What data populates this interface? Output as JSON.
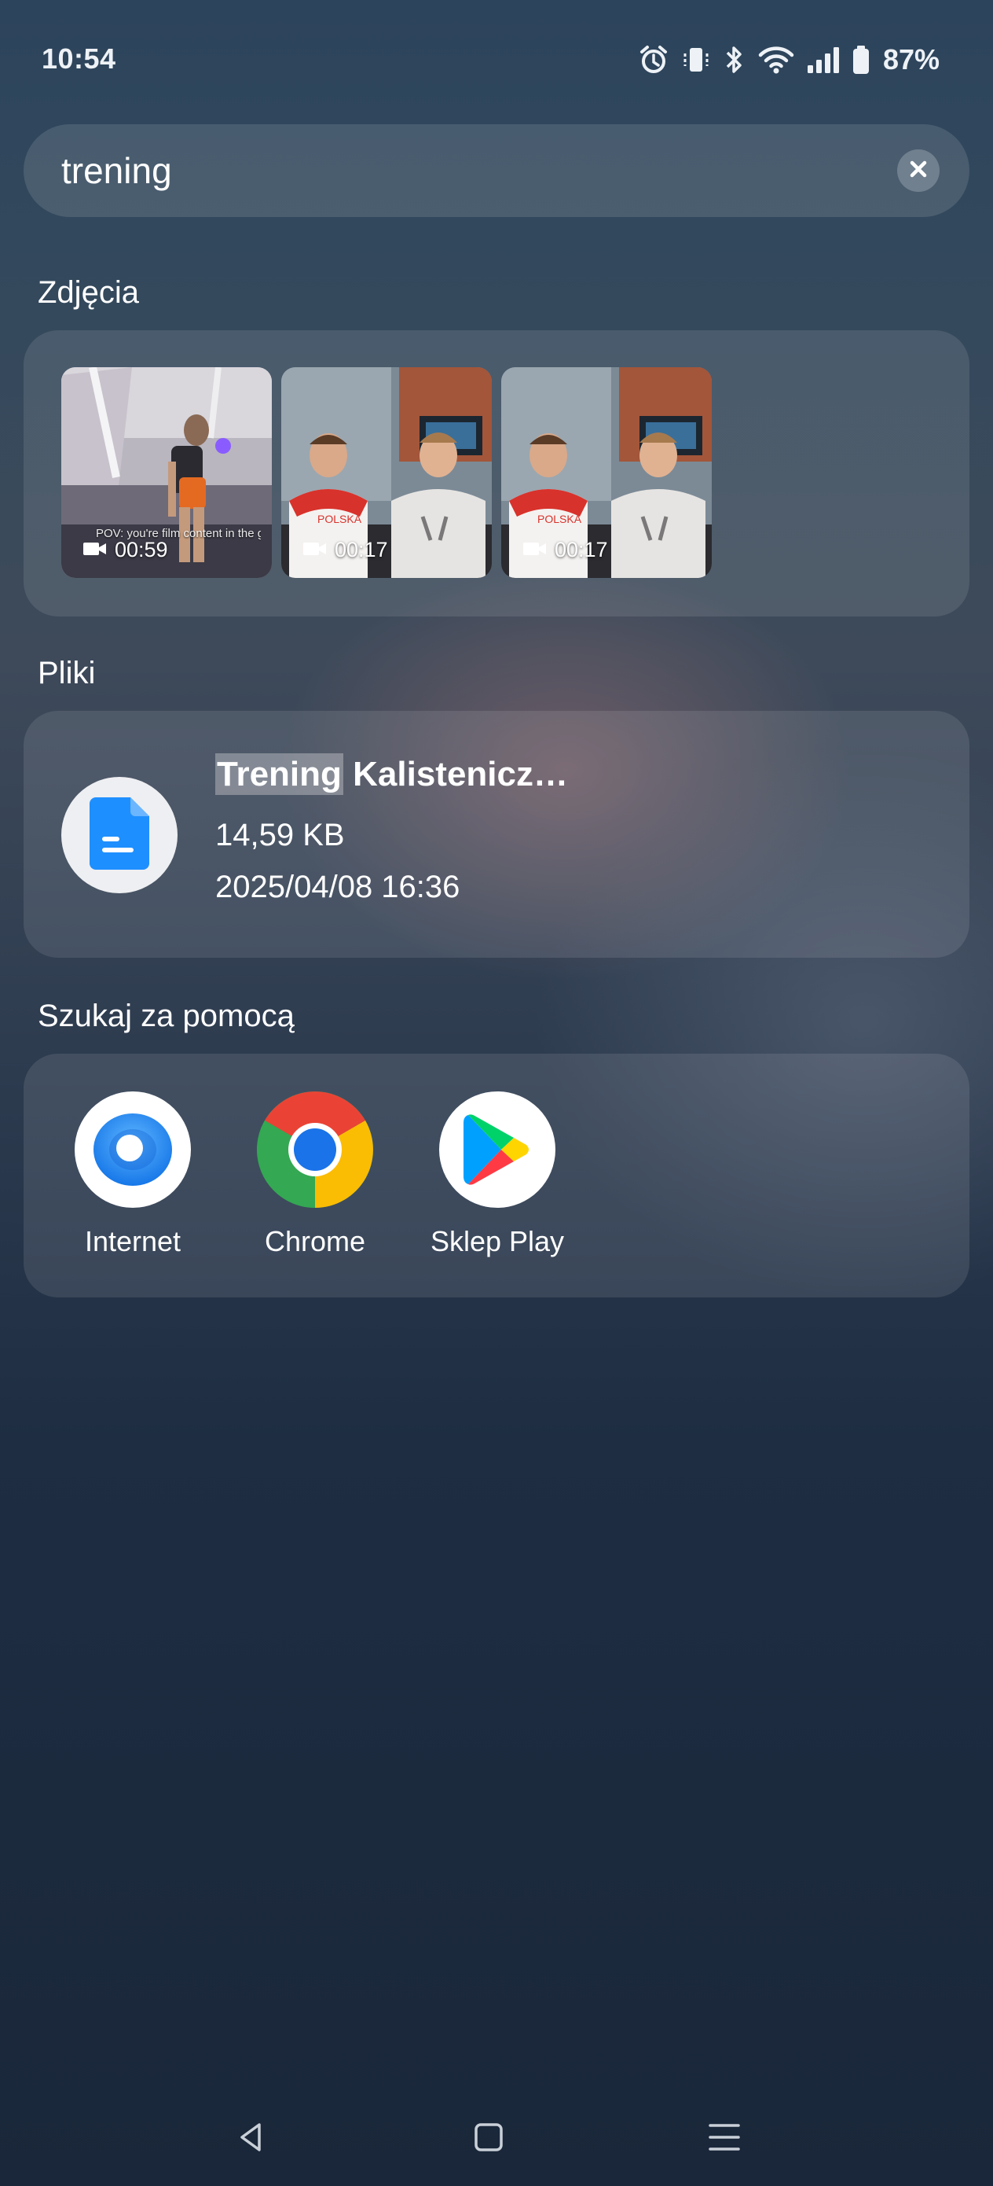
{
  "status_bar": {
    "time": "10:54",
    "battery_percent": "87%",
    "icons": [
      "alarm-icon",
      "vibrate-icon",
      "bluetooth-icon",
      "wifi-icon",
      "signal-icon",
      "battery-icon"
    ]
  },
  "search": {
    "query": "trening",
    "clear_icon": "close-icon"
  },
  "sections": {
    "photos_title": "Zdjęcia",
    "files_title": "Pliki",
    "search_with_title": "Szukaj za pomocą"
  },
  "photos": [
    {
      "duration": "00:59",
      "type": "video",
      "caption": "POV: you're film content in the gym ... happens 😳"
    },
    {
      "duration": "00:17",
      "type": "video"
    },
    {
      "duration": "00:17",
      "type": "video"
    }
  ],
  "files": [
    {
      "name_highlight": "Trening",
      "name_rest": " Kalistenicz…",
      "size": "14,59 KB",
      "date": "2025/04/08 16:36",
      "icon": "document-icon",
      "icon_color": "#1e8fff"
    }
  ],
  "search_with": [
    {
      "label": "Internet",
      "icon": "internet-icon"
    },
    {
      "label": "Chrome",
      "icon": "chrome-icon"
    },
    {
      "label": "Sklep Play",
      "icon": "play-store-icon"
    }
  ],
  "nav": {
    "icons": [
      "back-icon",
      "home-icon",
      "menu-icon"
    ]
  }
}
